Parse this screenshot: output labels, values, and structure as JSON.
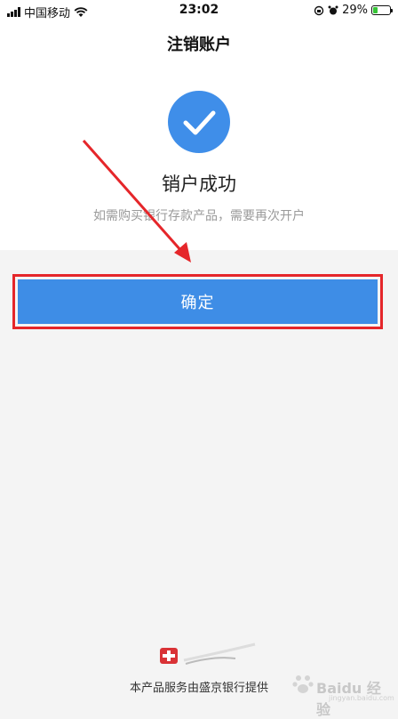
{
  "status_bar": {
    "carrier": "中国移动",
    "time": "23:02",
    "battery_percent": "29%",
    "battery_level": 0.29,
    "icons": [
      "signal-icon",
      "wifi-icon",
      "orientation-lock-icon",
      "alarm-icon",
      "battery-icon"
    ]
  },
  "header": {
    "title": "注销账户"
  },
  "result": {
    "icon": "check-icon",
    "title": "销户成功",
    "subtitle": "如需购买银行存款产品，需要再次开户"
  },
  "actions": {
    "confirm_label": "确定"
  },
  "footer": {
    "provider_text": "本产品服务由盛京银行提供",
    "logo": "bank-logo-icon"
  },
  "watermark": {
    "text": "Baidu 经验",
    "url": "jingyan.baidu.com"
  },
  "colors": {
    "primary": "#3e8de6",
    "highlight_border": "#e5262a",
    "annotation_arrow": "#e5262a",
    "background": "#f4f4f4"
  }
}
